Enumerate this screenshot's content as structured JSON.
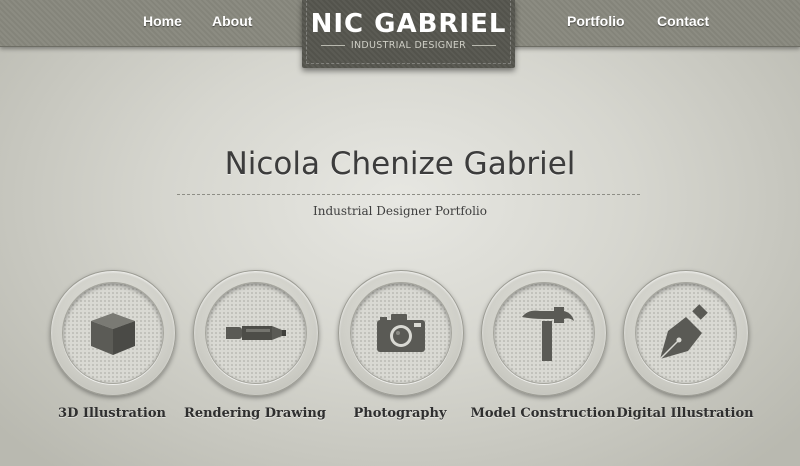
{
  "nav": {
    "home": "Home",
    "about": "About",
    "portfolio": "Portfolio",
    "contact": "Contact"
  },
  "logo": {
    "title": "NIC GABRIEL",
    "subtitle": "INDUSTRIAL DESIGNER"
  },
  "hero": {
    "title": "Nicola Chenize Gabriel",
    "subtitle": "Industrial Designer Portfolio"
  },
  "services": [
    {
      "label": "3D Illustration",
      "icon": "cube-icon"
    },
    {
      "label": "Rendering Drawing",
      "icon": "marker-icon"
    },
    {
      "label": "Photography",
      "icon": "camera-icon"
    },
    {
      "label": "Model Construction",
      "icon": "hammer-icon"
    },
    {
      "label": "Digital Illustration",
      "icon": "pen-nib-icon"
    }
  ],
  "colors": {
    "nav_bar": "#88887e",
    "logo_badge": "#57574f",
    "icon_fill": "#5a5a55",
    "text_dark": "#3c3c3c"
  }
}
